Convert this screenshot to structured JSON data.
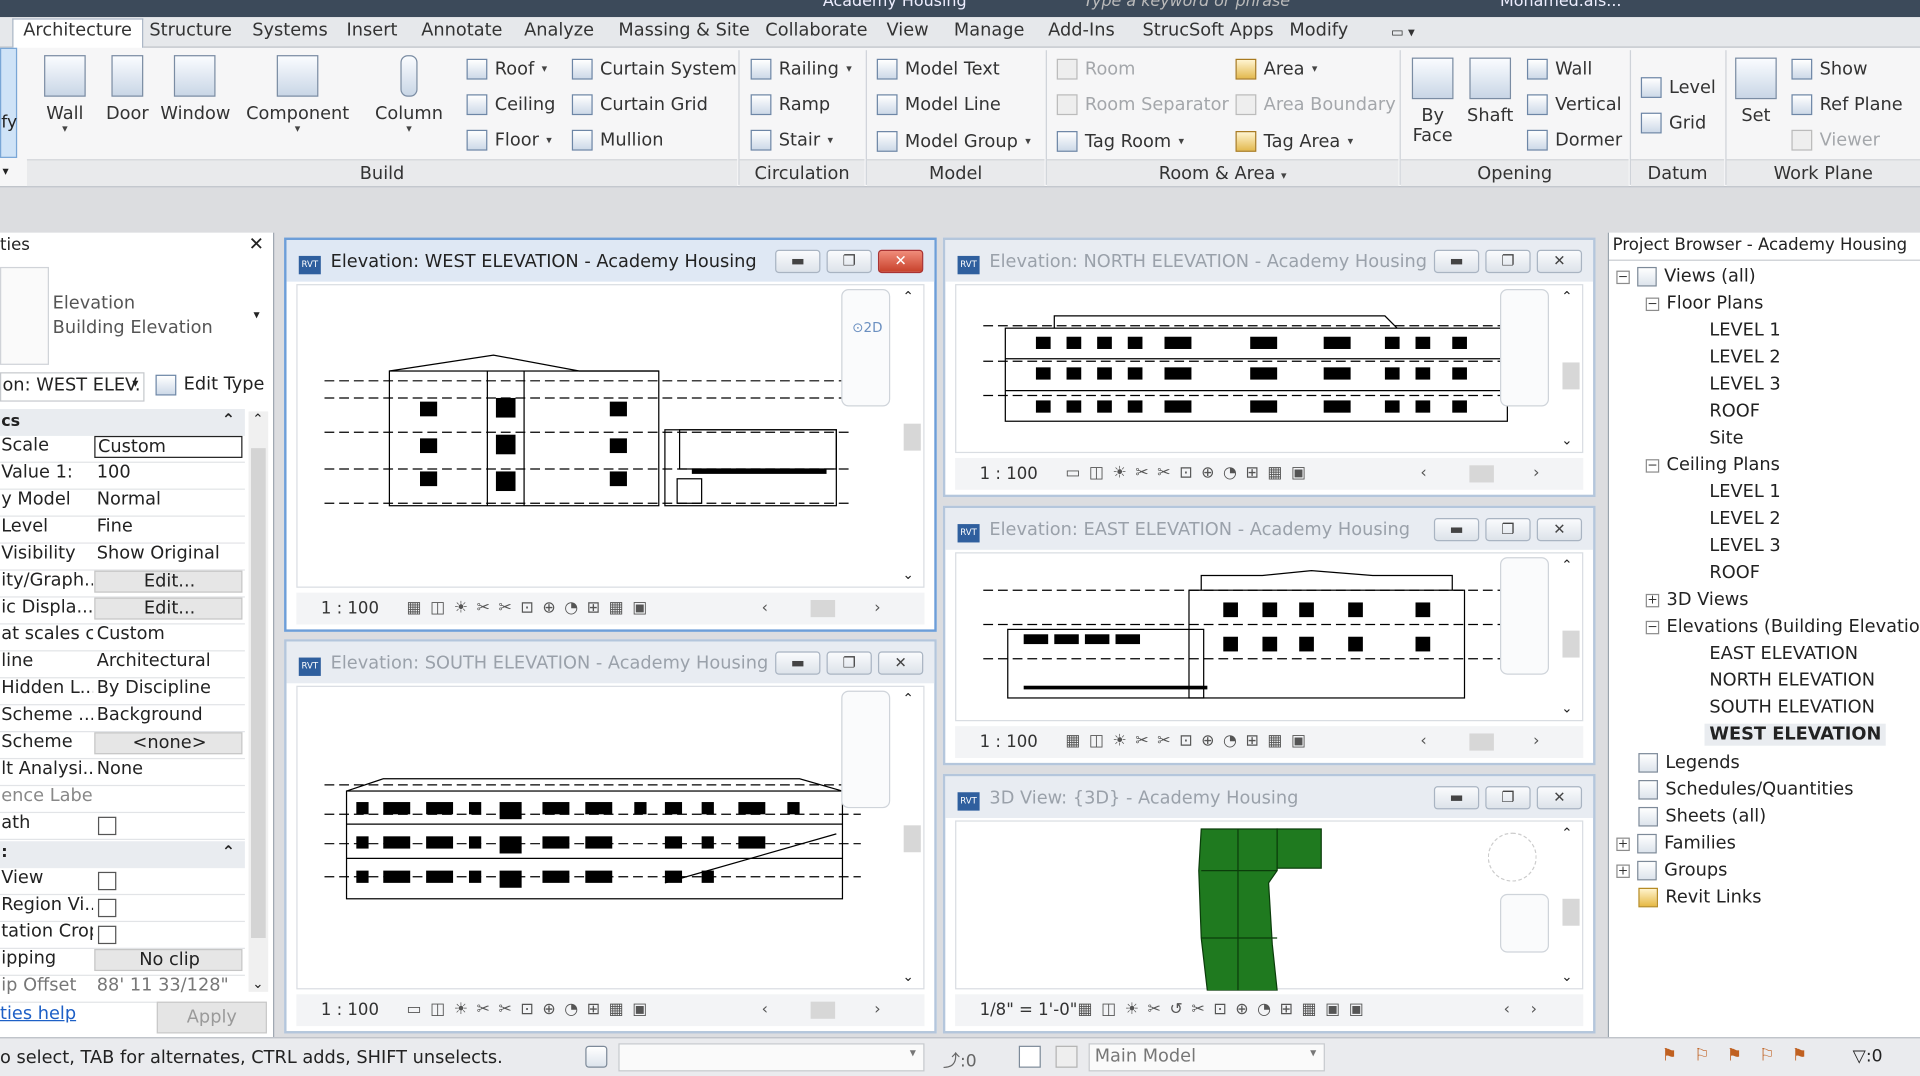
{
  "app": {
    "title": "Academy Housing",
    "search_placeholder": "Type a keyword or phrase",
    "user": "Mohamed.als..."
  },
  "tabs": [
    "Architecture",
    "Structure",
    "Systems",
    "Insert",
    "Annotate",
    "Analyze",
    "Massing & Site",
    "Collaborate",
    "View",
    "Manage",
    "Add-Ins",
    "StrucSoft Apps",
    "Modify"
  ],
  "ribbon": {
    "modify_label": "fy",
    "build": {
      "wall": "Wall",
      "door": "Door",
      "window": "Window",
      "component": "Component",
      "column": "Column",
      "roof": "Roof",
      "ceiling": "Ceiling",
      "floor": "Floor",
      "curtain_system": "Curtain System",
      "curtain_grid": "Curtain  Grid",
      "mullion": "Mullion",
      "group": "Build"
    },
    "circulation": {
      "railing": "Railing",
      "ramp": "Ramp",
      "stair": "Stair",
      "group": "Circulation"
    },
    "model": {
      "text": "Model  Text",
      "line": "Model  Line",
      "group_btn": "Model  Group",
      "group": "Model"
    },
    "room_area": {
      "room": "Room",
      "separator": "Room  Separator",
      "tag_room": "Tag  Room",
      "area": "Area",
      "area_boundary": "Area  Boundary",
      "tag_area": "Tag  Area",
      "group": "Room & Area"
    },
    "opening": {
      "by_face_1": "By",
      "by_face_2": "Face",
      "shaft": "Shaft",
      "wall": "Wall",
      "vertical": "Vertical",
      "dormer": "Dormer",
      "group": "Opening"
    },
    "datum": {
      "level": "Level",
      "grid": "Grid",
      "group": "Datum"
    },
    "work_plane": {
      "set": "Set",
      "show": "Show",
      "ref_plane": "Ref  Plane",
      "viewer": "Viewer",
      "group": "Work Plane"
    }
  },
  "properties": {
    "title": "ties",
    "type_1": "Elevation",
    "type_2": "Building Elevation",
    "instance_select": "on: WEST ELEV.",
    "edit_type": "Edit Type",
    "cat1": "cs",
    "rows": [
      {
        "k": "Scale",
        "v": "Custom"
      },
      {
        "k": "Value   1:",
        "v": "100"
      },
      {
        "k": "y Model",
        "v": "Normal"
      },
      {
        "k": " Level",
        "v": "Fine"
      },
      {
        "k": "Visibility",
        "v": "Show Original"
      },
      {
        "k": "ity/Graph...",
        "v": "Edit..."
      },
      {
        "k": "ic Displa...",
        "v": "Edit..."
      },
      {
        "k": "at scales c...",
        "v": "Custom"
      },
      {
        "k": "line",
        "v": "Architectural"
      },
      {
        "k": " Hidden L...",
        "v": "By Discipline"
      },
      {
        "k": " Scheme ...",
        "v": "Background"
      },
      {
        "k": " Scheme",
        "v": "<none>"
      },
      {
        "k": "lt Analysi...",
        "v": "None"
      },
      {
        "k": "ence Label",
        "v": ""
      },
      {
        "k": "ath",
        "v": ""
      }
    ],
    "rows2": [
      {
        "k": "View",
        "v": ""
      },
      {
        "k": "Region Vi...",
        "v": ""
      },
      {
        "k": "tation Crop",
        "v": ""
      },
      {
        "k": "ipping",
        "v": "No clip"
      },
      {
        "k": "ip Offset",
        "v": "88'  11 33/128\""
      }
    ],
    "help": "ties help",
    "apply": "Apply"
  },
  "views": {
    "west": {
      "title": "Elevation: WEST ELEVATION - Academy Housing",
      "scale": "1 : 100"
    },
    "north": {
      "title": "Elevation: NORTH ELEVATION - Academy Housing",
      "scale": "1 : 100"
    },
    "east": {
      "title": "Elevation: EAST ELEVATION - Academy Housing",
      "scale": "1 : 100"
    },
    "south": {
      "title": "Elevation: SOUTH ELEVATION - Academy Housing",
      "scale": "1 : 100"
    },
    "threed": {
      "title": "3D View: {3D} - Academy Housing",
      "scale": "1/8\" = 1'-0\""
    }
  },
  "browser": {
    "title": "Project Browser - Academy Housing",
    "views_all": "Views (all)",
    "floor_plans": "Floor Plans",
    "fp": [
      "LEVEL 1",
      "LEVEL 2",
      "LEVEL 3",
      "ROOF",
      "Site"
    ],
    "ceiling_plans": "Ceiling Plans",
    "cp": [
      "LEVEL 1",
      "LEVEL 2",
      "LEVEL 3",
      "ROOF"
    ],
    "views_3d": "3D Views",
    "elevations": "Elevations (Building Elevation)",
    "el": [
      "EAST ELEVATION",
      "NORTH ELEVATION",
      "SOUTH ELEVATION",
      "WEST ELEVATION"
    ],
    "legends": "Legends",
    "schedules": "Schedules/Quantities",
    "sheets": "Sheets (all)",
    "families": "Families",
    "groups": "Groups",
    "links": "Revit Links"
  },
  "status": {
    "message": "o select, TAB for alternates, CTRL adds, SHIFT unselects.",
    "count": ":0",
    "model": "Main Model",
    "filter_count": ":0"
  },
  "colors": {
    "accent": "#6d9ed8",
    "selection": "#e9ecf0",
    "model_green": "#1f7a1f"
  }
}
